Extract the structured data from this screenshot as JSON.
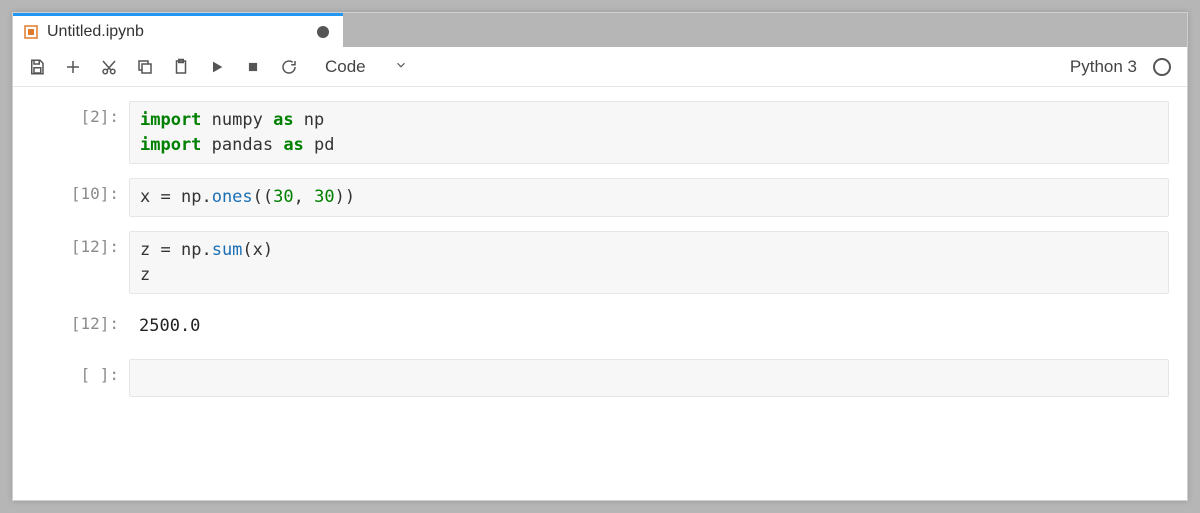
{
  "tab": {
    "title": "Untitled.ipynb",
    "dirty": true
  },
  "toolbar": {
    "cell_type": {
      "selected": "Code"
    },
    "kernel_name": "Python 3"
  },
  "cells": [
    {
      "kind": "code",
      "prompt": "[2]:",
      "tokens": [
        {
          "t": "import",
          "c": "kw"
        },
        {
          "t": " numpy ",
          "c": ""
        },
        {
          "t": "as",
          "c": "kw"
        },
        {
          "t": " np",
          "c": ""
        },
        {
          "t": "\n",
          "c": ""
        },
        {
          "t": "import",
          "c": "kw"
        },
        {
          "t": " pandas ",
          "c": ""
        },
        {
          "t": "as",
          "c": "kw"
        },
        {
          "t": " pd",
          "c": ""
        }
      ]
    },
    {
      "kind": "code",
      "prompt": "[10]:",
      "tokens": [
        {
          "t": "x ",
          "c": ""
        },
        {
          "t": "=",
          "c": "punc"
        },
        {
          "t": " np",
          "c": ""
        },
        {
          "t": ".",
          "c": "punc"
        },
        {
          "t": "ones",
          "c": "fn"
        },
        {
          "t": "((",
          "c": "punc"
        },
        {
          "t": "30",
          "c": "num"
        },
        {
          "t": ", ",
          "c": "punc"
        },
        {
          "t": "30",
          "c": "num"
        },
        {
          "t": "))",
          "c": "punc"
        }
      ]
    },
    {
      "kind": "code",
      "prompt": "[12]:",
      "tokens": [
        {
          "t": "z ",
          "c": ""
        },
        {
          "t": "=",
          "c": "punc"
        },
        {
          "t": " np",
          "c": ""
        },
        {
          "t": ".",
          "c": "punc"
        },
        {
          "t": "sum",
          "c": "fn"
        },
        {
          "t": "(",
          "c": "punc"
        },
        {
          "t": "x",
          "c": ""
        },
        {
          "t": ")",
          "c": "punc"
        },
        {
          "t": "\n",
          "c": ""
        },
        {
          "t": "z",
          "c": ""
        }
      ]
    },
    {
      "kind": "output",
      "prompt": "[12]:",
      "text": "2500.0"
    },
    {
      "kind": "code",
      "prompt": "[ ]:",
      "active": true,
      "tokens": [
        {
          "t": " ",
          "c": ""
        }
      ]
    }
  ]
}
